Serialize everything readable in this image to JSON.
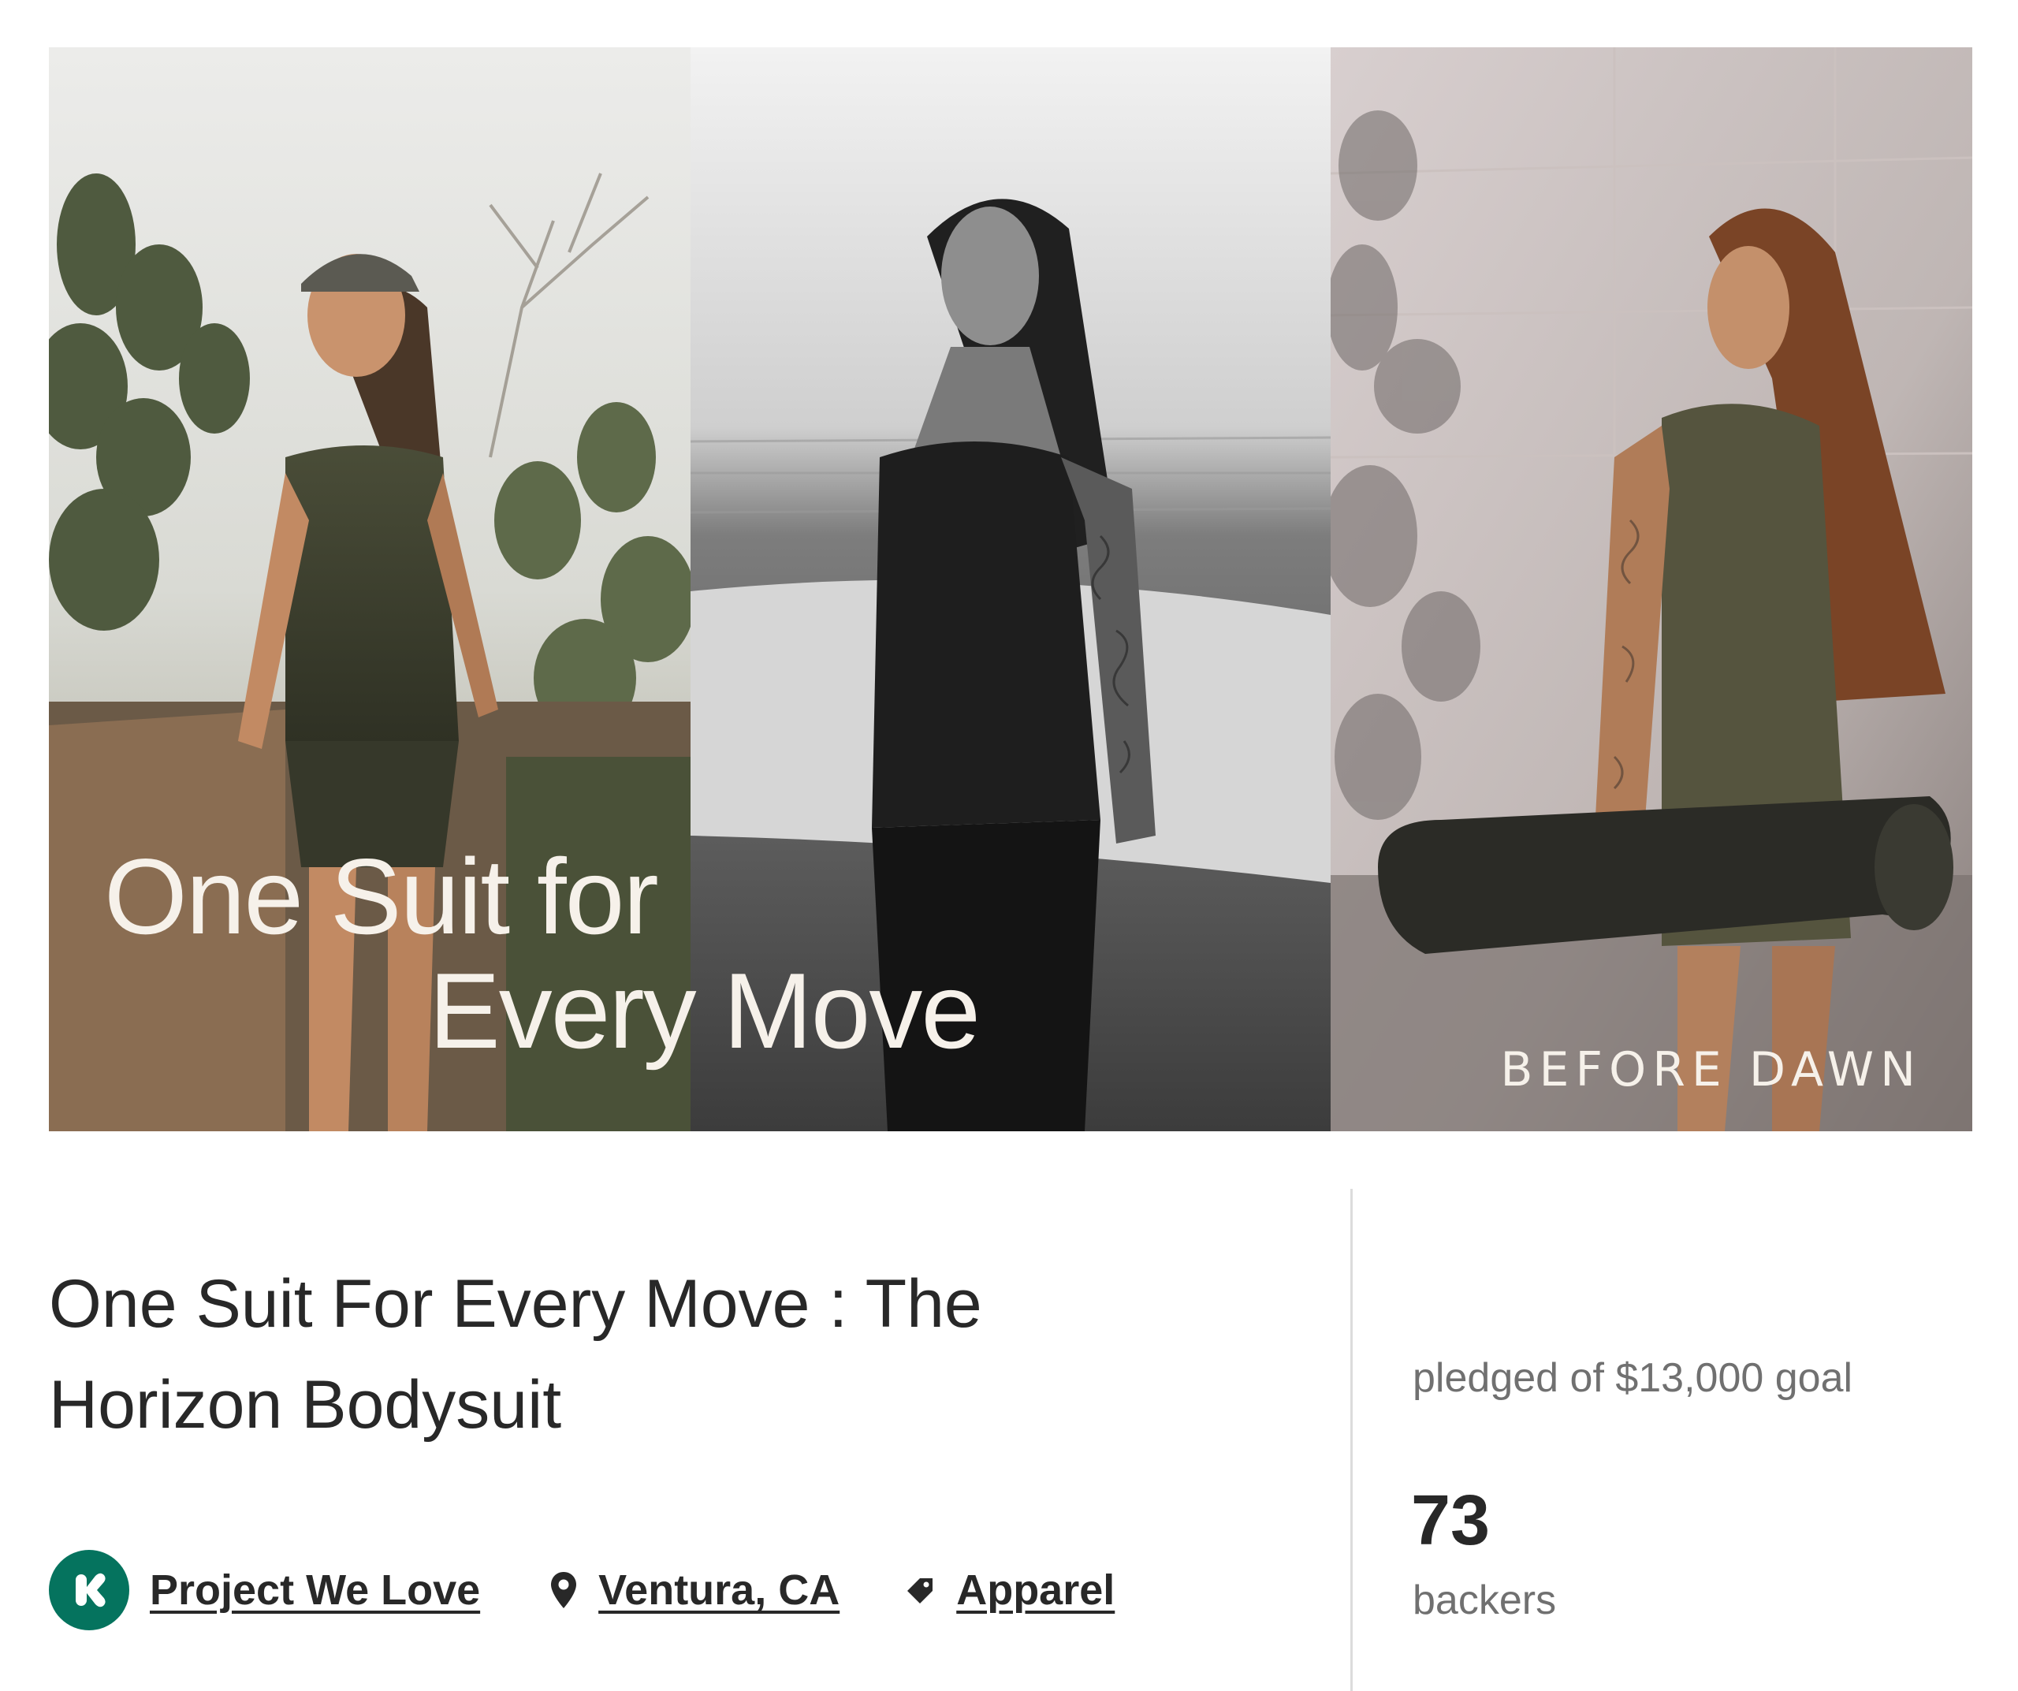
{
  "hero": {
    "headline_line1": "One Suit for",
    "headline_line2": "Every Move",
    "brand_wordmark": "BEFORE DAWN",
    "panels": [
      {
        "name": "woman-in-cap-among-cacti",
        "tone": "color"
      },
      {
        "name": "woman-holding-surfboard-on-beach",
        "tone": "black-and-white"
      },
      {
        "name": "woman-carrying-yoga-mat",
        "tone": "color"
      }
    ]
  },
  "project": {
    "title": "One Suit For Every Move : The Horizon Bodysuit",
    "badge_label": "Project We Love",
    "location": "Ventura, CA",
    "category": "Apparel"
  },
  "stats": {
    "pledged_label": "pledged of $13,000 goal",
    "backers_count": "73",
    "backers_label": "backers"
  },
  "colors": {
    "badge_green": "#05735e",
    "text_dark": "#282828",
    "text_muted": "#707070",
    "divider": "#dcdcdc",
    "hero_text": "#f6f1ea"
  },
  "icons": [
    "kickstarter-k-icon",
    "location-pin-icon",
    "tag-icon"
  ]
}
